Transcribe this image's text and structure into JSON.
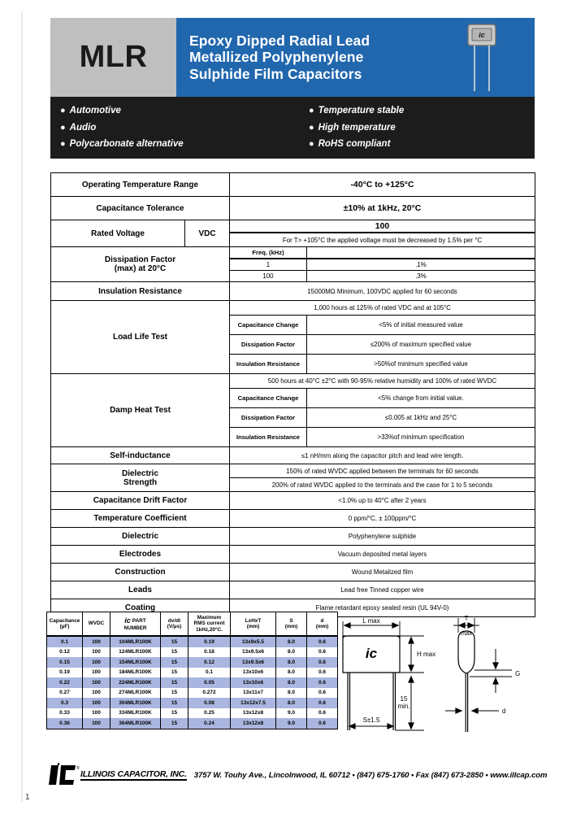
{
  "header": {
    "series": "MLR",
    "title_lines": [
      "Epoxy Dipped Radial Lead",
      "Metallized Polyphenylene",
      "Sulphide Film Capacitors"
    ],
    "photo_logo": "ic",
    "gray_bg": "#bfbfbf",
    "blue_bg": "#2167ae"
  },
  "features": {
    "left": [
      "Automotive",
      "Audio",
      "Polycarbonate alternative"
    ],
    "right": [
      "Temperature stable",
      "High temperature",
      "RoHS compliant"
    ],
    "bg": "#1c1c1c"
  },
  "spec": {
    "rows": [
      {
        "label": "Operating Temperature Range",
        "value": "-40°C to +125°C"
      },
      {
        "label": "Capacitance Tolerance",
        "value": "±10% at 1kHz, 20°C"
      },
      {
        "label": "Rated Voltage",
        "unit": "VDC",
        "value": "100",
        "note": "For T> +105°C the applied voltage must be decreased by 1.5% per °C"
      },
      {
        "label": "Dissipation Factor\n(max) at 20°C",
        "freq_header": "Freq. (kHz)",
        "freqs": [
          {
            "freq": "1",
            "value": ".1%"
          },
          {
            "freq": "100",
            "value": ".3%"
          }
        ]
      },
      {
        "label": "Insulation Resistance",
        "value": "15000MΩ Minimum, 100VDC applied for 60 seconds"
      },
      {
        "label": "Load Life Test",
        "condition": "1,000 hours at 125% of rated VDC and at 105°C",
        "sub": [
          {
            "name": "Capacitance Change",
            "value": "<5% of initial measured value"
          },
          {
            "name": "Dissipation Factor",
            "value": "≤200% of maximum specified value"
          },
          {
            "name": "Insulation Resistance",
            "value": ">50%of minimum specified value"
          }
        ]
      },
      {
        "label": "Damp Heat Test",
        "condition": "500 hours at 40°C ±2°C with 90-95% relative humidity and 100% of rated WVDC",
        "sub": [
          {
            "name": "Capacitance Change",
            "value": "<5% change from initial value."
          },
          {
            "name": "Dissipation Factor",
            "value": "≤0.005 at 1kHz and 25°C"
          },
          {
            "name": "Insulation Resistance",
            "value": ">33%of minimum specification"
          }
        ]
      },
      {
        "label": "Self-inductance",
        "value": "≤1 nH/mm along the capacitor pitch and lead wire length."
      },
      {
        "label": "Dielectric\nStrength",
        "values": [
          "150% of rated WVDC applied between the terminals for 60 seconds",
          "200% of rated WVDC applied to the terminals and the case for 1 to 5 seconds"
        ]
      },
      {
        "label": "Capacitance Drift Factor",
        "value": "<1.0% up to 40°C after 2 years"
      },
      {
        "label": "Temperature Coefficient",
        "value": "0 ppm/°C, ± 100ppm/°C"
      },
      {
        "label": "Dielectric",
        "value": "Polyphenylene sulphide"
      },
      {
        "label": "Electrodes",
        "value": "Vacuum deposited metal layers"
      },
      {
        "label": "Construction",
        "value": "Wound Metalized film"
      },
      {
        "label": "Leads",
        "value": "Lead free Tinned copper wire"
      },
      {
        "label": "Coating",
        "value": "Flame retardant epoxy sealed resin (UL 94V-0)"
      }
    ]
  },
  "part_table": {
    "headers": [
      "Capacitance\n(µF)",
      "WVDC",
      "PART\nNUMBER",
      "dv/dt\n(V/µs)",
      "Maximum\nRMS current\n1kHz,20°C.",
      "LxHxT\n(mm)",
      "S\n(mm)",
      "d\n(mm)"
    ],
    "logo": "ic",
    "shade_color": "#aab6e0",
    "rows": [
      {
        "cap": "0.1",
        "wvdc": "100",
        "pn": "104MLR100K",
        "dvdt": "15",
        "rms": "0.19",
        "lht": "13x9x5.5",
        "s": "8.0",
        "d": "0.6"
      },
      {
        "cap": "0.12",
        "wvdc": "100",
        "pn": "124MLR100K",
        "dvdt": "15",
        "rms": "0.18",
        "lht": "13x9.5x6",
        "s": "8.0",
        "d": "0.6"
      },
      {
        "cap": "0.15",
        "wvdc": "100",
        "pn": "154MLR100K",
        "dvdt": "15",
        "rms": "0.12",
        "lht": "13x9.5x6",
        "s": "8.0",
        "d": "0.6"
      },
      {
        "cap": "0.19",
        "wvdc": "100",
        "pn": "184MLR100K",
        "dvdt": "15",
        "rms": "0.1",
        "lht": "13x10x6",
        "s": "8.0",
        "d": "0.6"
      },
      {
        "cap": "0.22",
        "wvdc": "100",
        "pn": "224MLR100K",
        "dvdt": "15",
        "rms": "0.05",
        "lht": "13x10x6",
        "s": "8.0",
        "d": "0.6"
      },
      {
        "cap": "0.27",
        "wvdc": "100",
        "pn": "274MLR100K",
        "dvdt": "15",
        "rms": "0.272",
        "lht": "13x11x7",
        "s": "8.0",
        "d": "0.6"
      },
      {
        "cap": "0.3",
        "wvdc": "100",
        "pn": "304MLR100K",
        "dvdt": "15",
        "rms": "0.08",
        "lht": "13x12x7.5",
        "s": "8.0",
        "d": "0.6"
      },
      {
        "cap": "0.33",
        "wvdc": "100",
        "pn": "334MLR100K",
        "dvdt": "15",
        "rms": "0.25",
        "lht": "13x12x8",
        "s": "9.0",
        "d": "0.6"
      },
      {
        "cap": "0.36",
        "wvdc": "100",
        "pn": "364MLR100K",
        "dvdt": "15",
        "rms": "0.24",
        "lht": "13x12x8",
        "s": "9.0",
        "d": "0.6"
      }
    ]
  },
  "drawings": {
    "front": {
      "logo": "ic",
      "l_max": "L max",
      "h_max": "H max",
      "lead_len": "15\nmin.",
      "pitch": "S±1.5"
    },
    "side": {
      "t_max": "T\nmax",
      "gap": "G",
      "dia": "d"
    }
  },
  "footer": {
    "company": "ILLINOIS CAPACITOR, INC.",
    "address": "3757 W. Touhy Ave., Lincolnwood, IL 60712 • (847) 675-1760 • Fax (847) 673-2850 • www.illcap.com",
    "page": "1"
  }
}
